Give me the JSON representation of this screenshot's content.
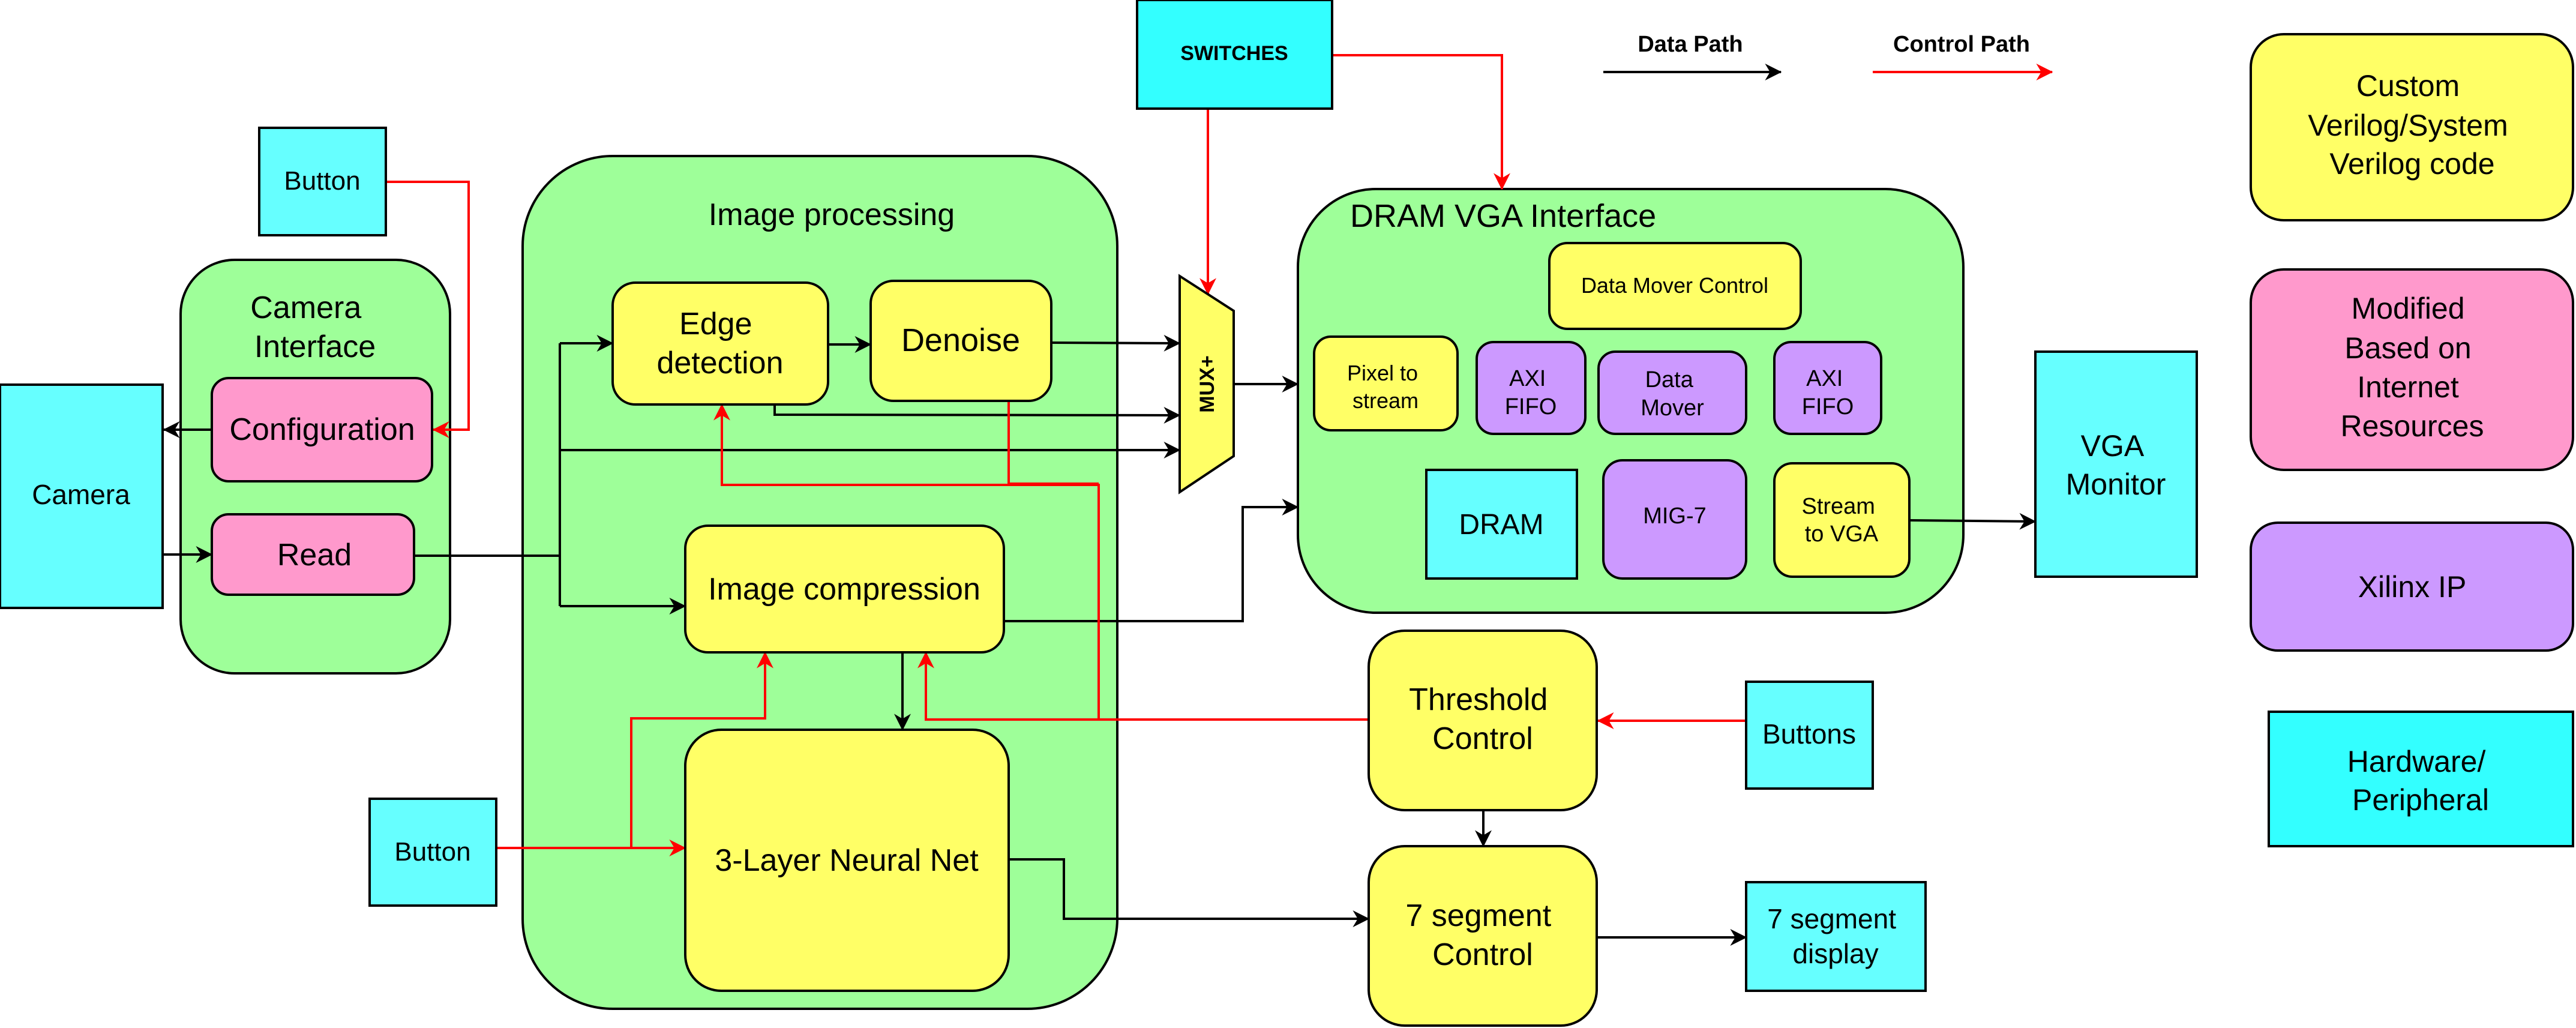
{
  "legend": {
    "data_path": "Data Path",
    "control_path": "Control Path",
    "categories": [
      {
        "label": [
          "Custom",
          "Verilog/System",
          "Verilog code"
        ],
        "color": "#ffff66"
      },
      {
        "label": [
          "Modified",
          "Based on",
          "Internet",
          "Resources"
        ],
        "color": "#ff99cc"
      },
      {
        "label": [
          "Xilinx IP"
        ],
        "color": "#cc99ff"
      },
      {
        "label": [
          "Hardware/",
          "Peripheral"
        ],
        "color": "#33ffff"
      }
    ]
  },
  "colors": {
    "container": "#9eff99",
    "custom": "#ffff66",
    "modified": "#ff99cc",
    "xilinx": "#cc99ff",
    "hardware": "#66ffff",
    "data_path": "#000000",
    "control_path": "#ff0000"
  },
  "blocks": {
    "button_top": "Button",
    "camera": "Camera",
    "camera_interface": [
      "Camera",
      "Interface"
    ],
    "configuration": "Configuration",
    "read": "Read",
    "image_processing": "Image processing",
    "edge_detection": [
      "Edge",
      "detection"
    ],
    "denoise": "Denoise",
    "image_compression": "Image compression",
    "neural_net": "3-Layer Neural Net",
    "button_bottom": "Button",
    "switches": "SWITCHES",
    "mux": "MUX+",
    "dram_vga_interface": "DRAM VGA Interface",
    "data_mover_control": "Data Mover Control",
    "pixel_to_stream": [
      "Pixel to",
      "stream"
    ],
    "axi_fifo_1": [
      "AXI",
      "FIFO"
    ],
    "data_mover": [
      "Data",
      "Mover"
    ],
    "axi_fifo_2": [
      "AXI",
      "FIFO"
    ],
    "dram": "DRAM",
    "mig7": "MIG-7",
    "stream_to_vga": [
      "Stream",
      "to VGA"
    ],
    "vga_monitor": [
      "VGA",
      "Monitor"
    ],
    "threshold_control": [
      "Threshold",
      "Control"
    ],
    "buttons": "Buttons",
    "seven_seg_control": [
      "7 segment",
      "Control"
    ],
    "seven_seg_display": [
      "7 segment",
      "display"
    ]
  }
}
